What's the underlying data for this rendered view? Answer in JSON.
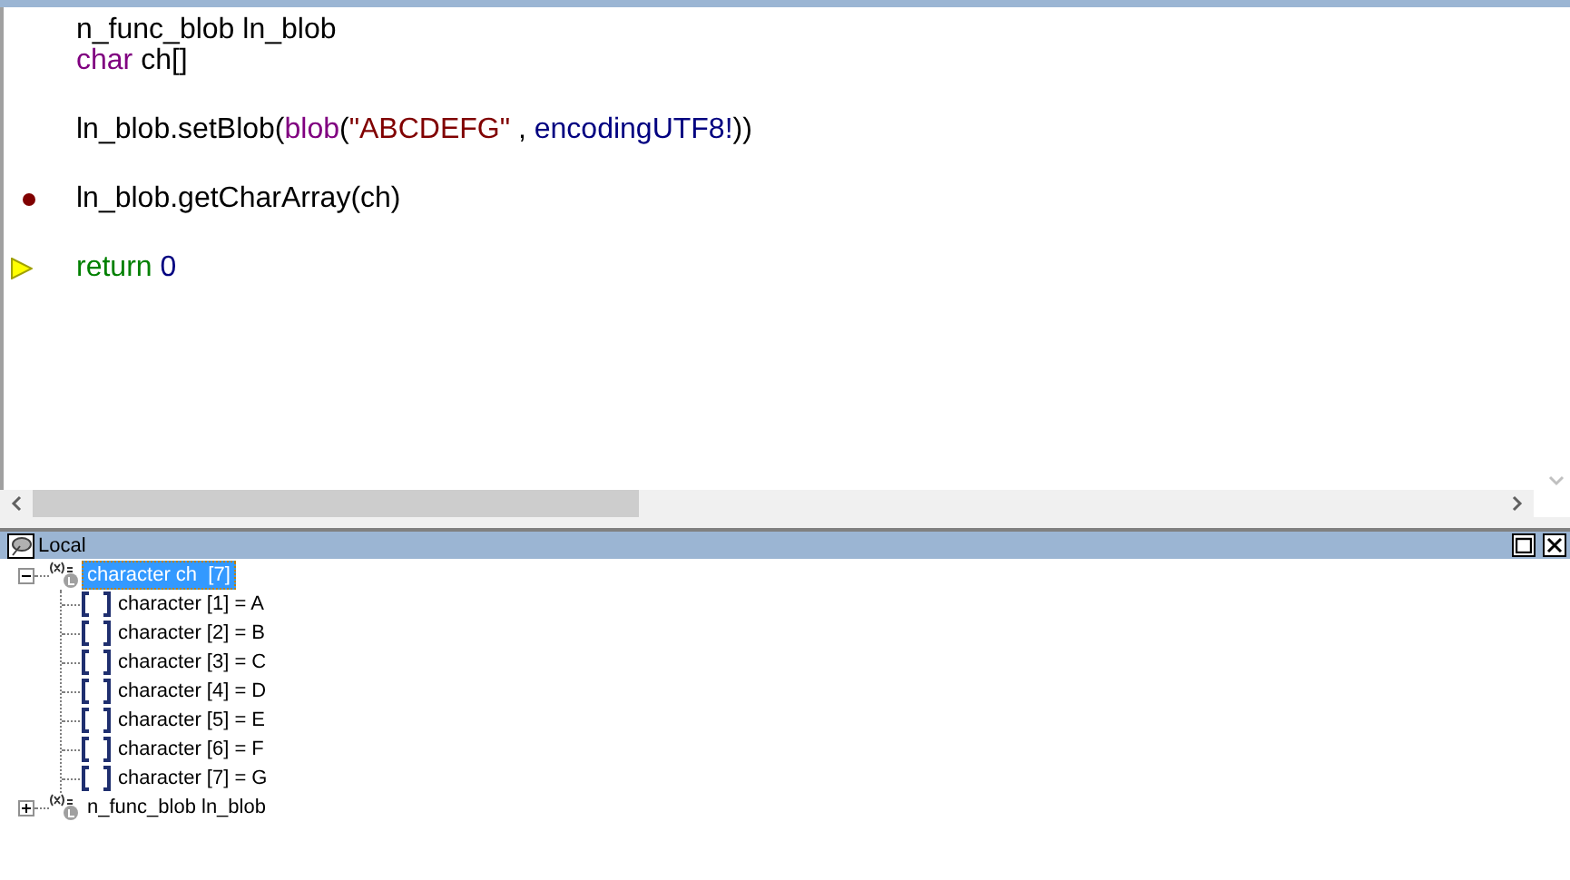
{
  "editor": {
    "lines": [
      {
        "kind": "code",
        "tokens": [
          {
            "kind": "plain",
            "text": "n_func_blob ln_blob"
          }
        ]
      },
      {
        "kind": "code",
        "tokens": [
          {
            "kind": "keyword",
            "text": "char"
          },
          {
            "kind": "plain",
            "text": " ch[]"
          }
        ]
      },
      {
        "kind": "blank"
      },
      {
        "kind": "code",
        "tokens": [
          {
            "kind": "plain",
            "text": "ln_blob.setBlob("
          },
          {
            "kind": "keyword",
            "text": "blob"
          },
          {
            "kind": "plain",
            "text": "("
          },
          {
            "kind": "string",
            "text": "\"ABCDEFG\""
          },
          {
            "kind": "plain",
            "text": " , "
          },
          {
            "kind": "enum",
            "text": "encodingUTF8!"
          },
          {
            "kind": "plain",
            "text": "))"
          }
        ]
      },
      {
        "kind": "blank"
      },
      {
        "kind": "code",
        "breakpoint": true,
        "tokens": [
          {
            "kind": "plain",
            "text": "ln_blob.getCharArray(ch)"
          }
        ]
      },
      {
        "kind": "blank"
      },
      {
        "kind": "code",
        "current": true,
        "tokens": [
          {
            "kind": "control",
            "text": "return"
          },
          {
            "kind": "number",
            "text": "0",
            "space_before": true
          }
        ]
      }
    ]
  },
  "locals_pane": {
    "title": "Local",
    "tree": [
      {
        "label": "character ch  [7]",
        "expanded": true,
        "selected": true,
        "children": [
          {
            "label": "character [1] = A",
            "selected": false
          },
          {
            "label": "character [2] = B",
            "selected": false
          },
          {
            "label": "character [3] = C",
            "selected": false
          },
          {
            "label": "character [4] = D",
            "selected": false
          },
          {
            "label": "character [5] = E",
            "selected": false
          },
          {
            "label": "character [6] = F",
            "selected": false
          },
          {
            "label": "character [7] = G",
            "selected": false
          }
        ]
      },
      {
        "label": "n_func_blob ln_blob",
        "expanded": false,
        "selected": false
      }
    ]
  }
}
